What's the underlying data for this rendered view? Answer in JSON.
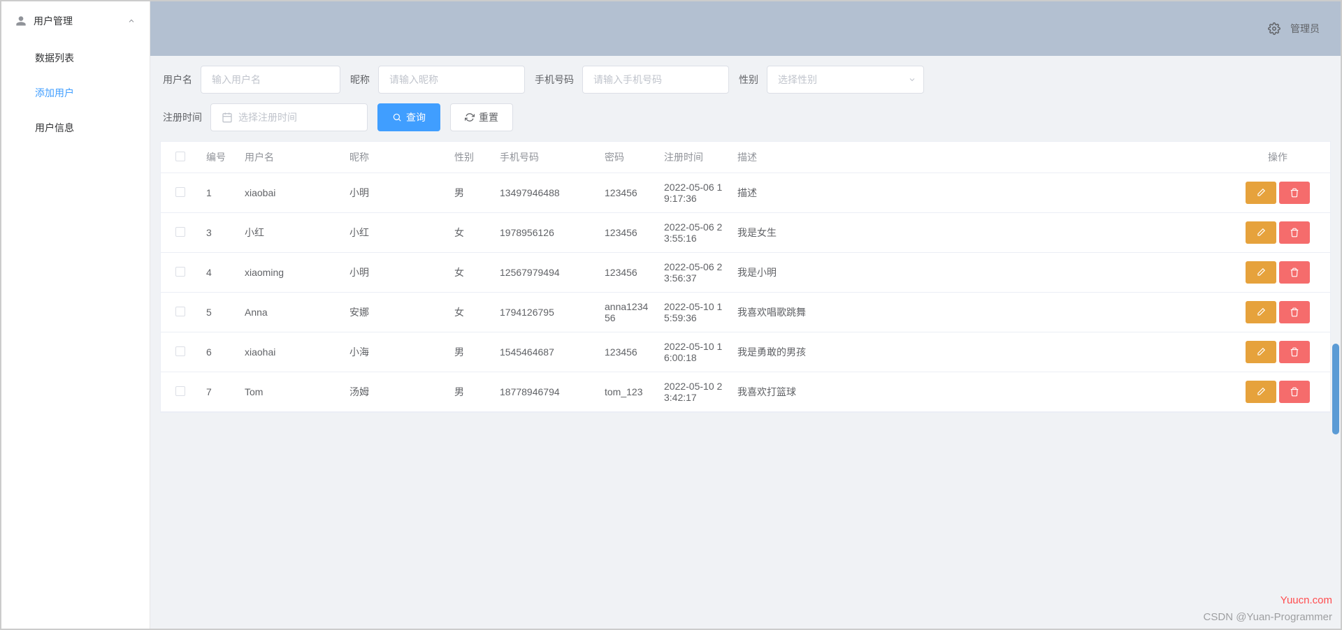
{
  "sidebar": {
    "title": "用户管理",
    "items": [
      {
        "label": "数据列表",
        "active": false
      },
      {
        "label": "添加用户",
        "active": true
      },
      {
        "label": "用户信息",
        "active": false
      }
    ]
  },
  "topbar": {
    "role": "管理员"
  },
  "filters": {
    "username_label": "用户名",
    "username_placeholder": "输入用户名",
    "nickname_label": "昵称",
    "nickname_placeholder": "请输入昵称",
    "phone_label": "手机号码",
    "phone_placeholder": "请输入手机号码",
    "gender_label": "性别",
    "gender_placeholder": "选择性别",
    "regtime_label": "注册时间",
    "regtime_placeholder": "选择注册时间",
    "search_btn": "查询",
    "reset_btn": "重置"
  },
  "table": {
    "headers": {
      "id": "编号",
      "username": "用户名",
      "nickname": "昵称",
      "gender": "性别",
      "phone": "手机号码",
      "password": "密码",
      "regtime": "注册时间",
      "desc": "描述",
      "op": "操作"
    },
    "rows": [
      {
        "id": "1",
        "username": "xiaobai",
        "nickname": "小明",
        "gender": "男",
        "phone": "13497946488",
        "password": "123456",
        "regtime": "2022-05-06 19:17:36",
        "desc": "描述"
      },
      {
        "id": "3",
        "username": "小红",
        "nickname": "小红",
        "gender": "女",
        "phone": "1978956126",
        "password": "123456",
        "regtime": "2022-05-06 23:55:16",
        "desc": "我是女生"
      },
      {
        "id": "4",
        "username": "xiaoming",
        "nickname": "小明",
        "gender": "女",
        "phone": "12567979494",
        "password": "123456",
        "regtime": "2022-05-06 23:56:37",
        "desc": "我是小明"
      },
      {
        "id": "5",
        "username": "Anna",
        "nickname": "安娜",
        "gender": "女",
        "phone": "1794126795",
        "password": "anna123456",
        "regtime": "2022-05-10 15:59:36",
        "desc": "我喜欢唱歌跳舞"
      },
      {
        "id": "6",
        "username": "xiaohai",
        "nickname": "小海",
        "gender": "男",
        "phone": "1545464687",
        "password": "123456",
        "regtime": "2022-05-10 16:00:18",
        "desc": "我是勇敢的男孩"
      },
      {
        "id": "7",
        "username": "Tom",
        "nickname": "汤姆",
        "gender": "男",
        "phone": "18778946794",
        "password": "tom_123",
        "regtime": "2022-05-10 23:42:17",
        "desc": "我喜欢打篮球"
      }
    ]
  },
  "watermarks": {
    "site": "Yuucn.com",
    "author": "CSDN @Yuan-Programmer"
  }
}
